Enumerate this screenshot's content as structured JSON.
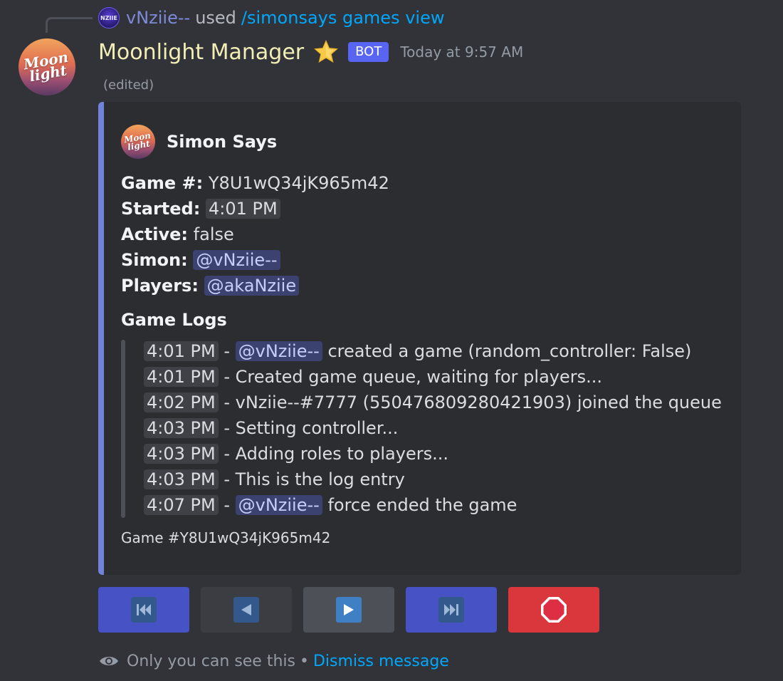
{
  "command": {
    "avatar_text": "NZIIE",
    "user": "vNziie--",
    "used": "used",
    "name": "/simonsays games view"
  },
  "author": {
    "avatar_text": "Moon light",
    "name": "Moonlight Manager",
    "badge": "BOT",
    "timestamp": "Today at 9:57 AM",
    "edited": "(edited)"
  },
  "embed": {
    "accent_color": "#6f83d8",
    "author_icon_text": "Moon light",
    "author_name": "Simon Says",
    "fields": {
      "game_label": "Game #:",
      "game_value": "Y8U1wQ34jK965m42",
      "started_label": "Started:",
      "started_value": "4:01 PM",
      "active_label": "Active:",
      "active_value": "false",
      "simon_label": "Simon:",
      "simon_value": "@vNziie--",
      "players_label": "Players:",
      "players_value": "@akaNziie"
    },
    "logs_title": "Game Logs",
    "logs": [
      {
        "time": "4:01 PM",
        "sep": " - ",
        "mention": "@vNziie--",
        "text": " created a game (random_controller: False)"
      },
      {
        "time": "4:01 PM",
        "sep": " - ",
        "text": "Created game queue, waiting for players..."
      },
      {
        "time": "4:02 PM",
        "sep": " - ",
        "text": "vNziie--#7777 (550476809280421903) joined the queue"
      },
      {
        "time": "4:03 PM",
        "sep": " - ",
        "text": "Setting controller..."
      },
      {
        "time": "4:03 PM",
        "sep": " - ",
        "text": "Adding roles to players..."
      },
      {
        "time": "4:03 PM",
        "sep": " - ",
        "text": "This is the log entry"
      },
      {
        "time": "4:07 PM",
        "sep": " - ",
        "mention": "@vNziie--",
        "text": " force ended the game"
      }
    ],
    "footer": "Game #Y8U1wQ34jK965m42"
  },
  "buttons": [
    {
      "name": "first-page-button",
      "icon": "first-page-icon",
      "style": "primary"
    },
    {
      "name": "previous-page-button",
      "icon": "previous-icon",
      "style": "secondary"
    },
    {
      "name": "next-page-button",
      "icon": "next-icon",
      "style": "secondary"
    },
    {
      "name": "last-page-button",
      "icon": "last-page-icon",
      "style": "primary"
    },
    {
      "name": "stop-button",
      "icon": "stop-sign-icon",
      "style": "danger"
    }
  ],
  "ephemeral": {
    "notice": "Only you can see this",
    "separator": "•",
    "dismiss": "Dismiss message"
  }
}
